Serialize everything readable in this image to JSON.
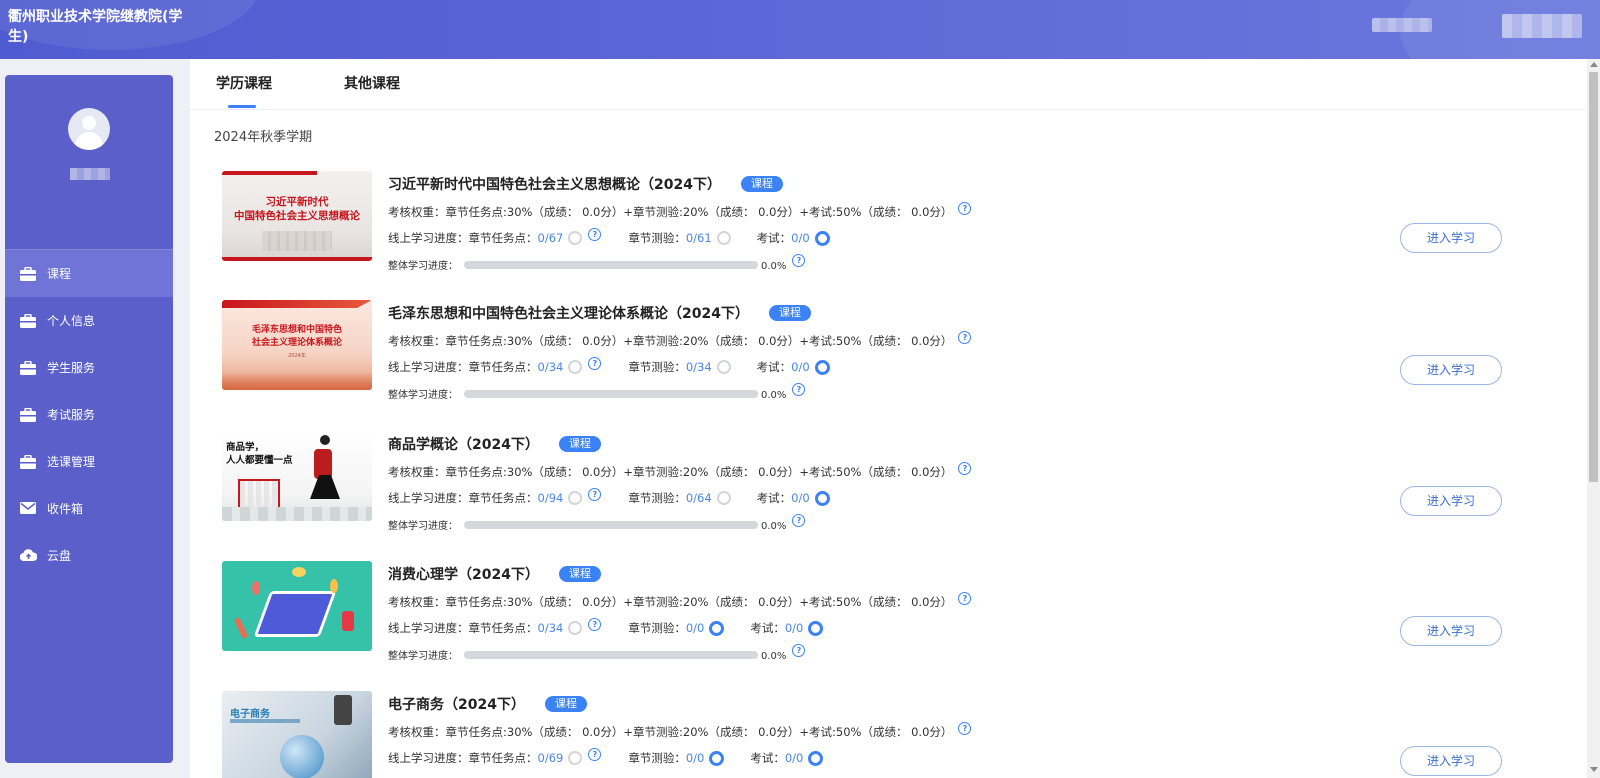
{
  "header": {
    "title": "衢州职业技术学院继教院(学生)"
  },
  "sidebar": {
    "items": [
      {
        "label": "课程",
        "icon": "briefcase-icon",
        "active": true
      },
      {
        "label": "个人信息",
        "icon": "briefcase-icon"
      },
      {
        "label": "学生服务",
        "icon": "briefcase-icon"
      },
      {
        "label": "考试服务",
        "icon": "briefcase-icon"
      },
      {
        "label": "选课管理",
        "icon": "briefcase-icon"
      },
      {
        "label": "收件箱",
        "icon": "mail-icon"
      },
      {
        "label": "云盘",
        "icon": "cloud-upload-icon"
      }
    ]
  },
  "tabs": [
    "学历课程",
    "其他课程"
  ],
  "semester": "2024年秋季学期",
  "labels": {
    "badge": "课程",
    "weight_prefix": "考核权重：",
    "weight_text": "章节任务点:30%（成绩： 0.0分）+章节测验:20%（成绩： 0.0分）+考试:50%（成绩： 0.0分）",
    "online_progress": "线上学习进度：",
    "task_points": "章节任务点：",
    "chapter_test": "章节测验：",
    "exam": "考试：",
    "overall": "整体学习进度：",
    "enter": "进入学习",
    "help": "?"
  },
  "colors": {
    "accent": "#3b82f6",
    "sidebar": "#5a5fc9",
    "header": "#5a66d6"
  },
  "courses": [
    {
      "name": "习近平新时代中国特色社会主义思想概论（2024下）",
      "thumb_title": "习近平新时代\n中国特色社会主义思想概论",
      "tasks": "0/67",
      "tests": "0/61",
      "tests_done": false,
      "exam": "0/0",
      "overall": "0.0%",
      "overall_value": 0
    },
    {
      "name": "毛泽东思想和中国特色社会主义理论体系概论（2024下）",
      "thumb_title": "毛泽东思想和中国特色\n社会主义理论体系概论",
      "thumb_sub": "2024年",
      "tasks": "0/34",
      "tests": "0/34",
      "tests_done": false,
      "exam": "0/0",
      "overall": "0.0%",
      "overall_value": 0
    },
    {
      "name": "商品学概论（2024下）",
      "thumb_title": "商品学，\n人人都要懂一点",
      "tasks": "0/94",
      "tests": "0/64",
      "tests_done": false,
      "exam": "0/0",
      "overall": "0.0%",
      "overall_value": 0
    },
    {
      "name": "消费心理学（2024下）",
      "thumb_title": "",
      "tasks": "0/34",
      "tests": "0/0",
      "tests_done": true,
      "exam": "0/0",
      "overall": "0.0%",
      "overall_value": 0
    },
    {
      "name": "电子商务（2024下）",
      "thumb_title": "电子商务",
      "tasks": "0/69",
      "tests": "0/0",
      "tests_done": true,
      "exam": "0/0",
      "overall": "0.0%",
      "overall_value": 0
    }
  ]
}
